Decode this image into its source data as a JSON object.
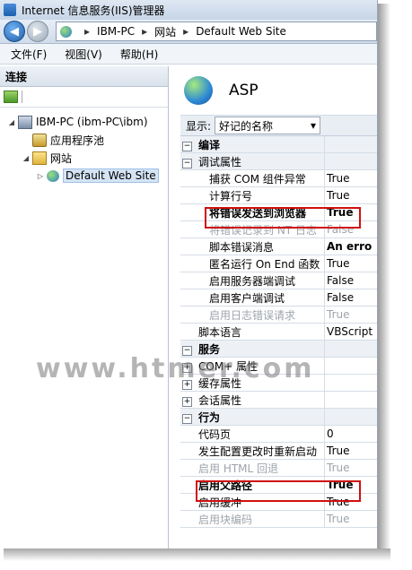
{
  "window": {
    "title": "Internet 信息服务(IIS)管理器"
  },
  "address": {
    "segments": [
      "IBM-PC",
      "网站",
      "Default Web Site"
    ]
  },
  "menu": [
    "文件(F)",
    "视图(V)",
    "帮助(H)"
  ],
  "connections": {
    "header": "连接",
    "tree": [
      {
        "label": "IBM-PC (ibm-PC\\ibm)",
        "icon": "computer-icon",
        "level": 0,
        "expanded": true
      },
      {
        "label": "应用程序池",
        "icon": "app-pool-icon",
        "level": 1
      },
      {
        "label": "网站",
        "icon": "folder-icon",
        "level": 1,
        "expanded": true
      },
      {
        "label": "Default Web Site",
        "icon": "globe-icon",
        "level": 2,
        "selected": true
      }
    ]
  },
  "feature": {
    "title": "ASP",
    "display_label": "显示:",
    "display_value": "好记的名称",
    "groups": [
      {
        "name": "编译",
        "expanded": false,
        "items": [
          {
            "name": "调试属性",
            "subgroup": true,
            "expanded": true
          }
        ]
      }
    ],
    "rows": [
      {
        "type": "cat",
        "name": "编译",
        "sign": "−"
      },
      {
        "type": "cat",
        "name": "调试属性",
        "sign": "−",
        "nonbold": true
      },
      {
        "type": "prop",
        "name": "捕获 COM 组件异常",
        "value": "True",
        "indent": 1
      },
      {
        "type": "prop",
        "name": "计算行号",
        "value": "True",
        "indent": 1
      },
      {
        "type": "prop",
        "name": "将错误发送到浏览器",
        "value": "True",
        "indent": 1,
        "bold": true,
        "highlight": true
      },
      {
        "type": "prop",
        "name": "将错误记录到 NT 日志",
        "value": "False",
        "indent": 1,
        "dim": true
      },
      {
        "type": "prop",
        "name": "脚本错误消息",
        "value": "An erro",
        "indent": 1,
        "boldvalue": true
      },
      {
        "type": "prop",
        "name": "匿名运行 On End 函数",
        "value": "True",
        "indent": 1
      },
      {
        "type": "prop",
        "name": "启用服务器端调试",
        "value": "False",
        "indent": 1
      },
      {
        "type": "prop",
        "name": "启用客户端调试",
        "value": "False",
        "indent": 1
      },
      {
        "type": "prop",
        "name": "启用日志错误请求",
        "value": "True",
        "indent": 1,
        "dim": true
      },
      {
        "type": "prop",
        "name": "脚本语言",
        "value": "VBScript",
        "indent": 0
      },
      {
        "type": "cat",
        "name": "服务",
        "sign": "−"
      },
      {
        "type": "sub",
        "name": "COM+ 属性",
        "sign": "+"
      },
      {
        "type": "sub",
        "name": "缓存属性",
        "sign": "+"
      },
      {
        "type": "sub",
        "name": "会话属性",
        "sign": "+"
      },
      {
        "type": "cat",
        "name": "行为",
        "sign": "−"
      },
      {
        "type": "prop",
        "name": "代码页",
        "value": "0",
        "indent": 0
      },
      {
        "type": "prop",
        "name": "发生配置更改时重新启动",
        "value": "True",
        "indent": 0
      },
      {
        "type": "prop",
        "name": "启用 HTML 回退",
        "value": "True",
        "indent": 0,
        "dim": true
      },
      {
        "type": "prop",
        "name": "启用父路径",
        "value": "True",
        "indent": 0,
        "bold": true,
        "highlight": true
      },
      {
        "type": "prop",
        "name": "启用缓冲",
        "value": "True",
        "indent": 0
      },
      {
        "type": "prop",
        "name": "启用块编码",
        "value": "True",
        "indent": 0,
        "dim": true
      }
    ]
  },
  "watermark": "www.htmer.com"
}
